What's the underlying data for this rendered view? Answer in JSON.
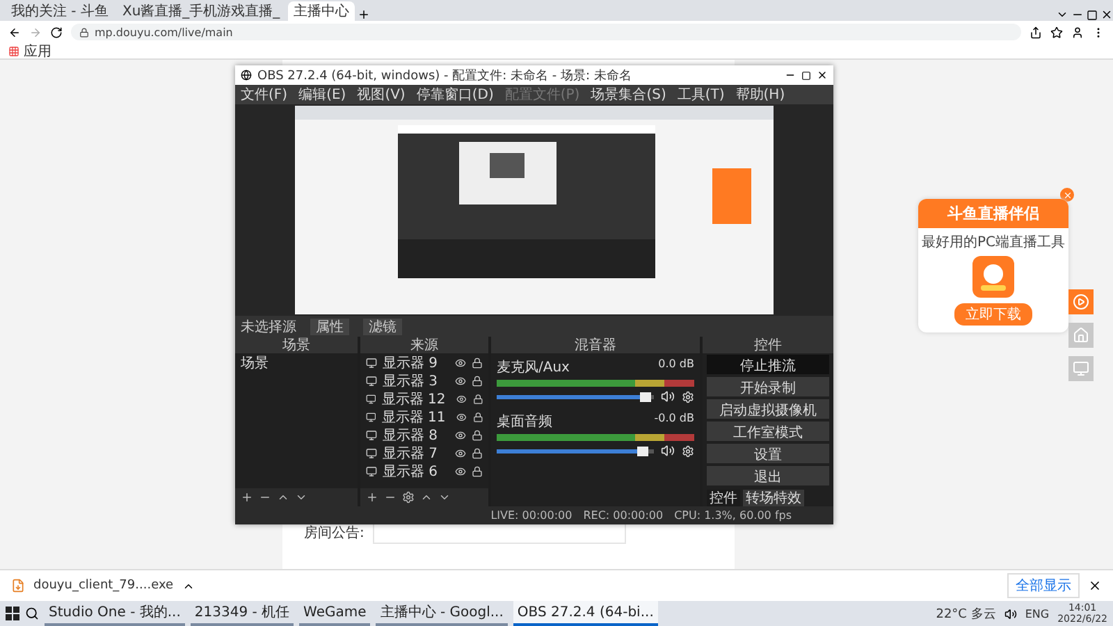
{
  "browser": {
    "tabs": [
      {
        "title": "我的关注 - 斗鱼",
        "selected": false
      },
      {
        "title": "Xu酱直播_手机游戏直播_",
        "selected": false
      },
      {
        "title": "主播中心",
        "selected": true
      }
    ],
    "url": "mp.douyu.com/live/main",
    "bookmarks": [
      "应用"
    ]
  },
  "page": {
    "notice_label": "房间公告:"
  },
  "obs": {
    "title": "OBS 27.2.4 (64-bit, windows) - 配置文件: 未命名 - 场景: 未命名",
    "menu": [
      {
        "label": "文件(F)",
        "disabled": false
      },
      {
        "label": "编辑(E)",
        "disabled": false
      },
      {
        "label": "视图(V)",
        "disabled": false
      },
      {
        "label": "停靠窗口(D)",
        "disabled": false
      },
      {
        "label": "配置文件(P)",
        "disabled": true
      },
      {
        "label": "场景集合(S)",
        "disabled": false
      },
      {
        "label": "工具(T)",
        "disabled": false
      },
      {
        "label": "帮助(H)",
        "disabled": false
      }
    ],
    "source_toolbar": {
      "label": "未选择源",
      "buttons": [
        "属性",
        "滤镜"
      ]
    },
    "scenes": {
      "title": "场景",
      "items": [
        "场景"
      ]
    },
    "sources": {
      "title": "来源",
      "items": [
        "显示器 9",
        "显示器 3",
        "显示器 12",
        "显示器 11",
        "显示器 8",
        "显示器 7",
        "显示器 6"
      ]
    },
    "mixer": {
      "title": "混音器",
      "channels": [
        {
          "name": "麦克风/Aux",
          "reading": "0.0 dB",
          "level": 0.95
        },
        {
          "name": "桌面音频",
          "reading": "-0.0 dB",
          "level": 0.93
        }
      ]
    },
    "controls": {
      "title": "控件",
      "buttons": [
        {
          "label": "停止推流",
          "active": true
        },
        {
          "label": "开始录制",
          "active": false
        },
        {
          "label": "启动虚拟摄像机",
          "active": false
        },
        {
          "label": "工作室模式",
          "active": false
        },
        {
          "label": "设置",
          "active": false
        },
        {
          "label": "退出",
          "active": false
        }
      ],
      "tabs": [
        {
          "label": "控件",
          "selected": true
        },
        {
          "label": "转场特效",
          "selected": false
        }
      ]
    },
    "status": {
      "live": "LIVE: 00:00:00",
      "rec": "REC: 00:00:00",
      "cpu": "CPU: 1.3%, 60.00 fps"
    }
  },
  "promo": {
    "title": "斗鱼直播伴侣",
    "subtitle": "最好用的PC端直播工具",
    "button": "立即下载"
  },
  "download": {
    "file": "douyu_client_79....exe",
    "show_all": "全部显示"
  },
  "taskbar": {
    "apps": [
      {
        "label": "Studio One - 我的...",
        "active": false
      },
      {
        "label": "213349 - 机任",
        "active": false
      },
      {
        "label": "WeGame",
        "active": false
      },
      {
        "label": "主播中心 - Googl...",
        "active": false
      },
      {
        "label": "OBS 27.2.4 (64-bi...",
        "active": true
      }
    ],
    "weather": "22°C 多云",
    "lang": "ENG",
    "time": "14:01",
    "date": "2022/6/22"
  }
}
